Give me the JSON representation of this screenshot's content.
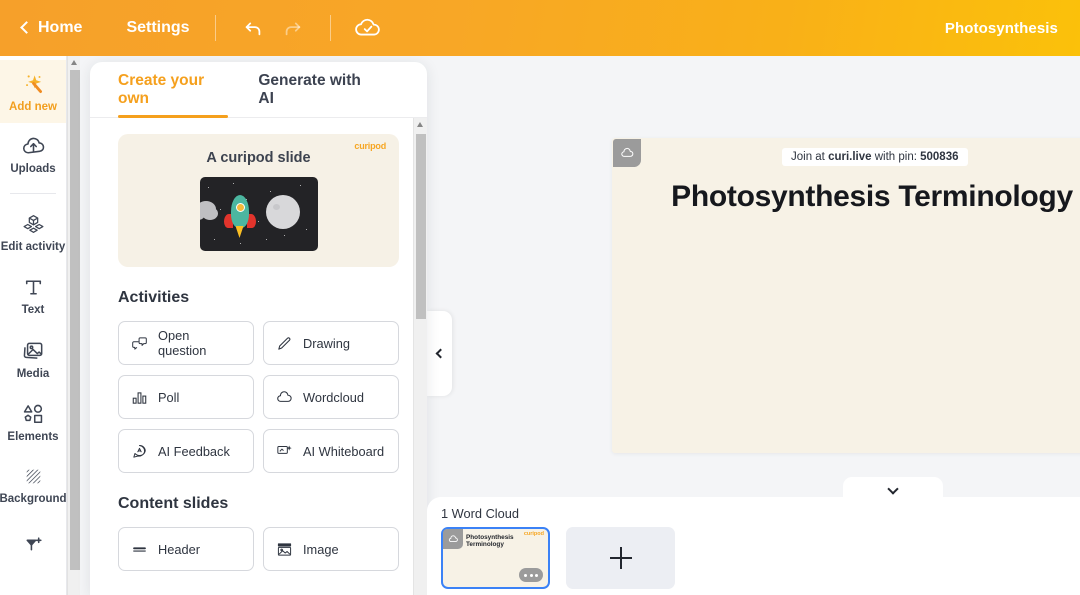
{
  "topbar": {
    "home_label": "Home",
    "settings_label": "Settings",
    "undo_icon": "undo-icon",
    "redo_icon": "redo-icon",
    "save_icon": "cloud-check-icon",
    "title": "Photosynthesis"
  },
  "rail": {
    "items": [
      {
        "label": "Add new",
        "icon": "magic-wand-icon",
        "active": true
      },
      {
        "label": "Uploads",
        "icon": "cloud-upload-icon",
        "active": false
      },
      {
        "label": "Edit activity",
        "icon": "blocks-icon",
        "active": false
      },
      {
        "label": "Text",
        "icon": "text-t-icon",
        "active": false
      },
      {
        "label": "Media",
        "icon": "image-stack-icon",
        "active": false
      },
      {
        "label": "Elements",
        "icon": "shapes-icon",
        "active": false
      },
      {
        "label": "Background",
        "icon": "hatch-pattern-icon",
        "active": false
      },
      {
        "label": "",
        "icon": "effects-wand-icon",
        "active": false
      }
    ]
  },
  "panel": {
    "tabs": [
      {
        "label": "Create your own",
        "active": true
      },
      {
        "label": "Generate with AI",
        "active": false
      }
    ],
    "promo": {
      "brand": "curipod",
      "title": "A curipod slide",
      "art": "rocket-moon-illustration"
    },
    "activities_title": "Activities",
    "activities": [
      {
        "label": "Open question",
        "icon": "speech-question-icon"
      },
      {
        "label": "Drawing",
        "icon": "pencil-icon"
      },
      {
        "label": "Poll",
        "icon": "bar-chart-icon"
      },
      {
        "label": "Wordcloud",
        "icon": "cloud-icon"
      },
      {
        "label": "AI Feedback",
        "icon": "ai-speech-icon"
      },
      {
        "label": "AI Whiteboard",
        "icon": "ai-whiteboard-icon"
      }
    ],
    "content_title": "Content slides",
    "content_slides": [
      {
        "label": "Header",
        "icon": "header-bar-icon"
      },
      {
        "label": "Image",
        "icon": "image-icon"
      }
    ]
  },
  "canvas": {
    "collapse_icon": "chevron-left-icon",
    "slide_cloud_icon": "cloud-icon",
    "pin_prefix": "Join at ",
    "pin_domain": "curi.live",
    "pin_middle": " with pin: ",
    "pin_code": "500836",
    "slide_title": "Photosynthesis Terminology",
    "expand_icon": "chevron-down-icon"
  },
  "strip": {
    "label": "1 Word Cloud",
    "thumbnail": {
      "brand": "curipod",
      "title": "Photosynthesis Terminology",
      "cloud_icon": "cloud-icon",
      "menu_icon": "ellipsis-icon",
      "selected": true
    },
    "add_label": "add-slide"
  },
  "colors": {
    "accent": "#f5a01d",
    "header_gradient_start": "#f6a02a",
    "header_gradient_end": "#fbc10a",
    "slide_bg": "#f7f2e6",
    "selection_blue": "#3b82f6",
    "app_bg": "#f4f5f7"
  }
}
